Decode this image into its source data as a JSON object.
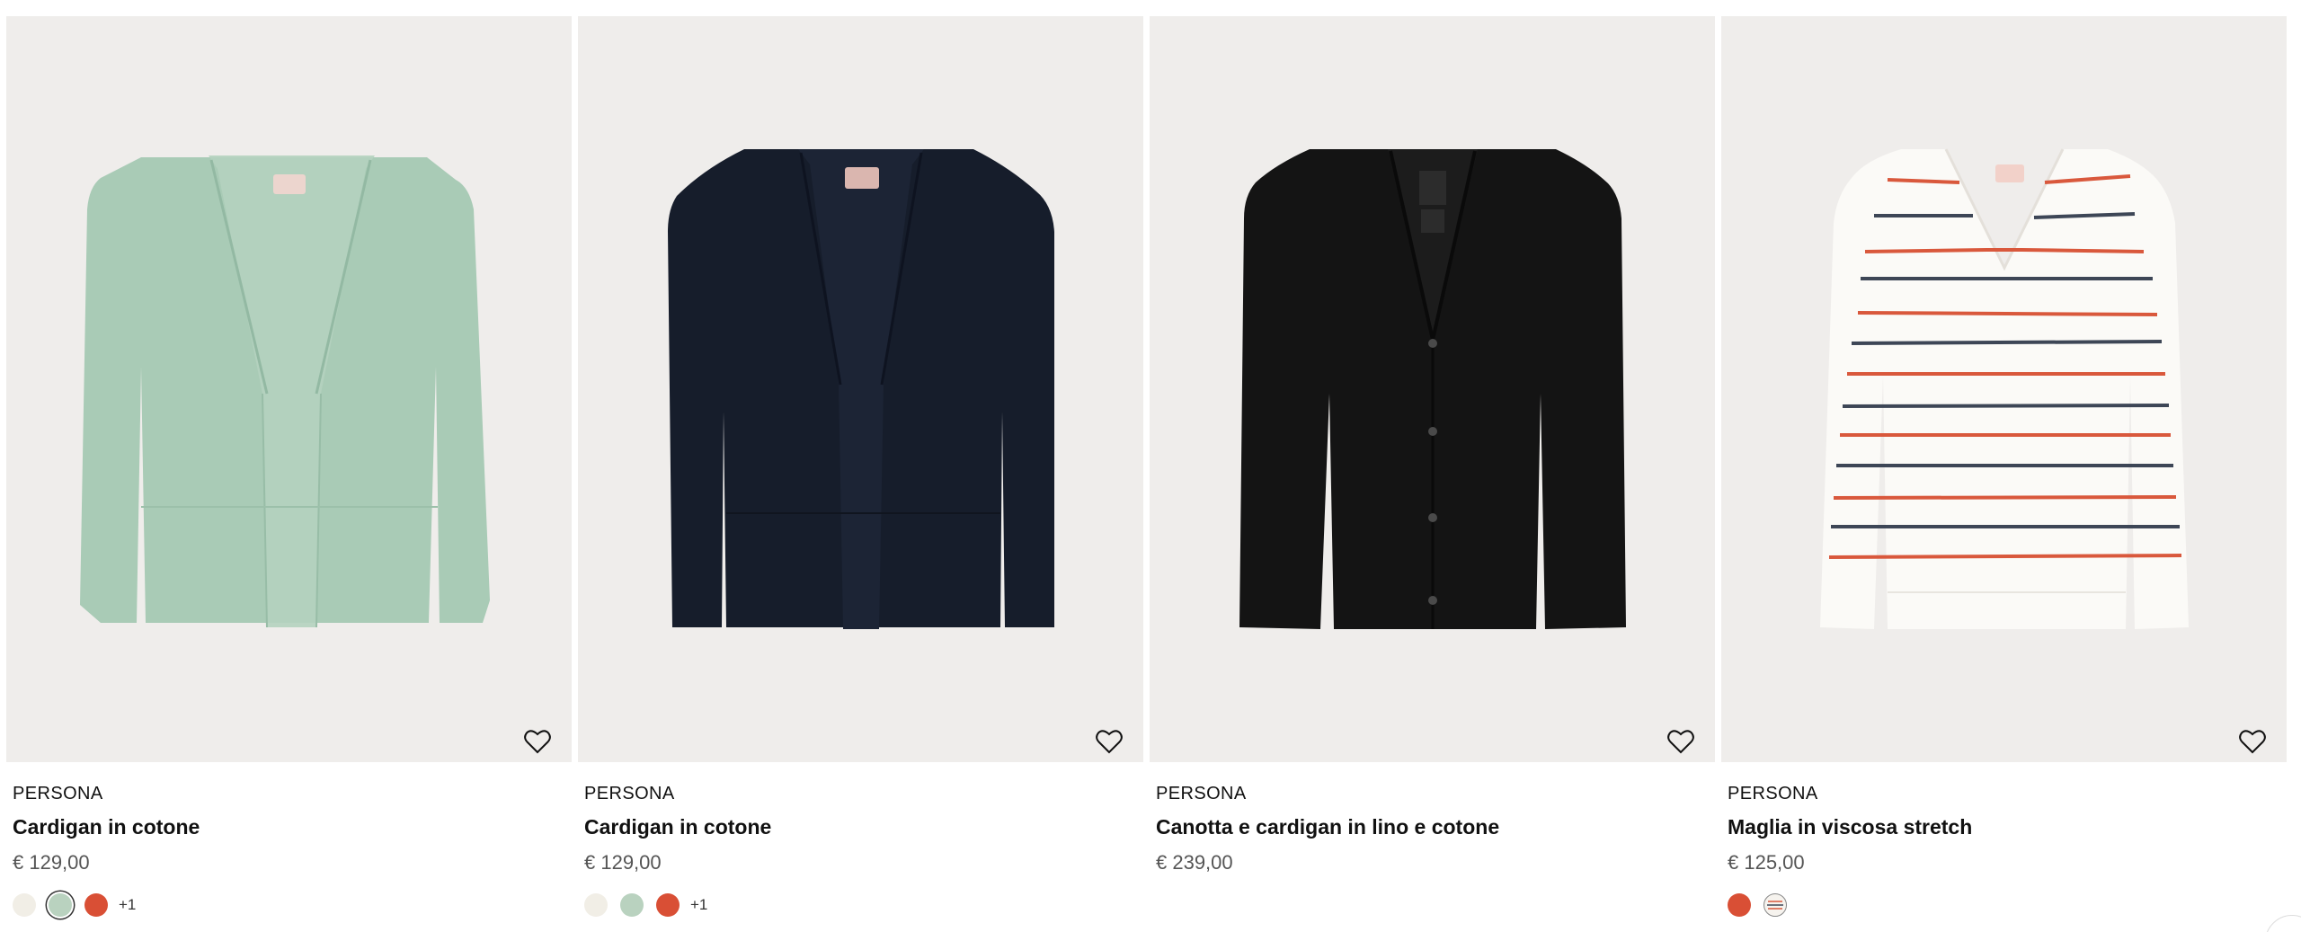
{
  "products": [
    {
      "brand": "PERSONA",
      "title": "Cardigan in cotone",
      "price": "€ 129,00",
      "garment": "green-open-cardigan",
      "garment_color": "#a8c9b5",
      "swatches": [
        {
          "name": "cream",
          "color": "#f1eee6",
          "selected": false
        },
        {
          "name": "sage",
          "color": "#b9d2bf",
          "selected": true
        },
        {
          "name": "red",
          "color": "#d94f35",
          "selected": false
        }
      ],
      "more_colors": "+1"
    },
    {
      "brand": "PERSONA",
      "title": "Cardigan in cotone",
      "price": "€ 129,00",
      "garment": "navy-open-cardigan",
      "garment_color": "#161d2b",
      "swatches": [
        {
          "name": "cream",
          "color": "#f1eee6",
          "selected": false
        },
        {
          "name": "sage",
          "color": "#b9d2bf",
          "selected": false
        },
        {
          "name": "red",
          "color": "#d94f35",
          "selected": false
        }
      ],
      "more_colors": "+1"
    },
    {
      "brand": "PERSONA",
      "title": "Canotta e cardigan in lino e cotone",
      "price": "€ 239,00",
      "garment": "black-button-cardigan",
      "garment_color": "#141414",
      "swatches": [],
      "more_colors": ""
    },
    {
      "brand": "PERSONA",
      "title": "Maglia in viscosa stretch",
      "price": "€ 125,00",
      "garment": "striped-vneck-sweater",
      "garment_color": "#fbfaf7",
      "stripe_colors": [
        "#d9583c",
        "#3d4656"
      ],
      "swatches": [
        {
          "name": "red",
          "color": "#d94f35",
          "selected": false
        },
        {
          "name": "striped",
          "color": "#f6f3ee",
          "selected": false
        }
      ],
      "more_colors": ""
    }
  ],
  "icons": {
    "favorite": "heart-outline-icon"
  }
}
